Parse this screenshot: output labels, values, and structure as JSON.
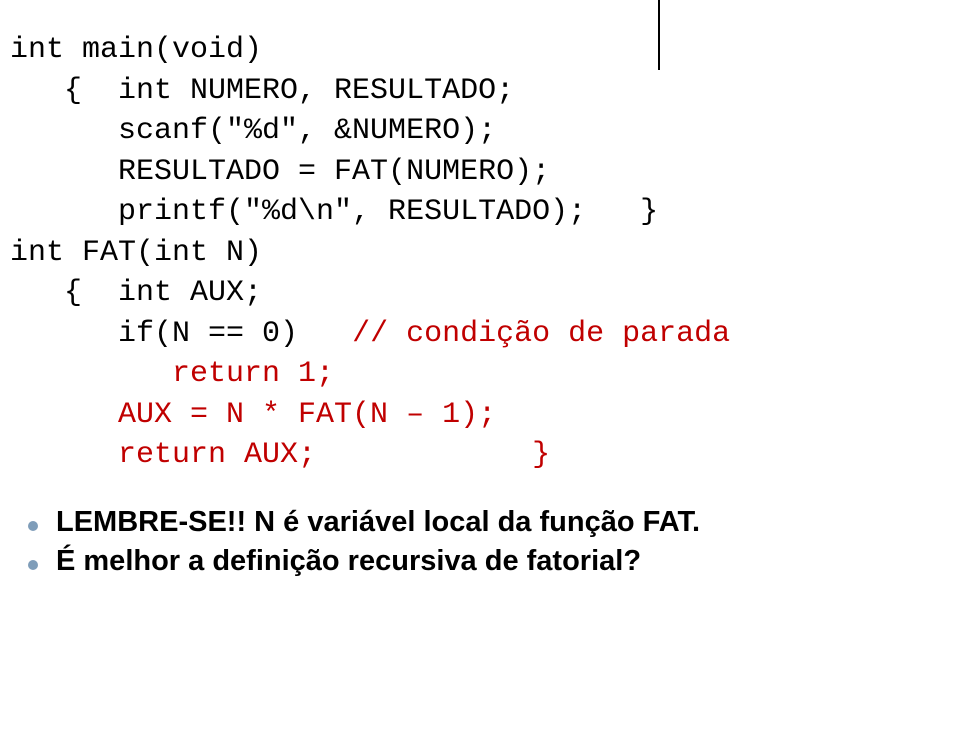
{
  "code": {
    "l1": "int main(void)",
    "l2": "   {  int NUMERO, RESULTADO;",
    "l3": "      scanf(\"%d\", &NUMERO);",
    "l4": "      RESULTADO = FAT(NUMERO);",
    "l5": "      printf(\"%d\\n\", RESULTADO);   }",
    "l6": "",
    "l7": "int FAT(int N)",
    "l8": "   {  int AUX;",
    "l9a": "      if(N == 0)   ",
    "l9b": "// condição de parada",
    "l10": "         return 1;",
    "l11": "      AUX = N * FAT(N – 1);",
    "l12": "      return AUX;            }"
  },
  "bullets": {
    "b1": "LEMBRE-SE!! N é variável local da função FAT.",
    "b2": "É melhor a definição recursiva de fatorial?"
  }
}
